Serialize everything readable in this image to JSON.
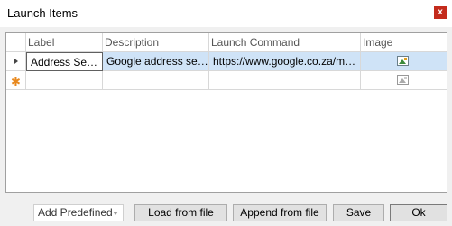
{
  "window": {
    "title": "Launch Items",
    "close_label": "x"
  },
  "grid": {
    "columns": [
      "Label",
      "Description",
      "Launch Command",
      "Image"
    ],
    "rows": [
      {
        "label": "Address Search",
        "description": "Google address search",
        "command": "https://www.google.co.za/maps/search/",
        "image": "image-icon"
      }
    ],
    "new_row_marker": "✱"
  },
  "buttons": {
    "add_predefined": "Add Predefined",
    "load_from_file": "Load from file",
    "append_from_file": "Append from file",
    "save": "Save",
    "ok": "Ok"
  },
  "colors": {
    "selection": "#cfe3f7",
    "close": "#c42b1c",
    "new_row_star": "#e8891f"
  }
}
